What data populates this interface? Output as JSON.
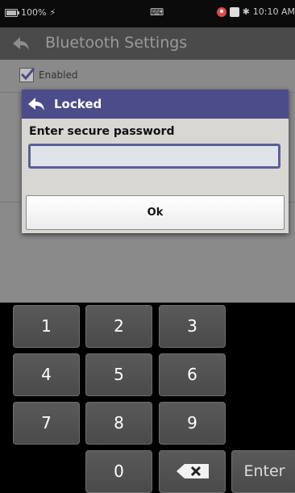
{
  "status_bar": {
    "battery": "100%",
    "time": "10:10 AM"
  },
  "app_bar": {
    "title": "Bluetooth Settings"
  },
  "background": {
    "enabled_label": "Enabled",
    "enabled_checked": true
  },
  "dialog": {
    "title": "Locked",
    "prompt": "Enter secure password",
    "password_value": "",
    "ok_label": "Ok",
    "header_color": "#4d4c8a"
  },
  "keypad": {
    "keys": [
      "1",
      "2",
      "3",
      "4",
      "5",
      "6",
      "7",
      "8",
      "9",
      "0"
    ],
    "enter_label": "Enter"
  }
}
